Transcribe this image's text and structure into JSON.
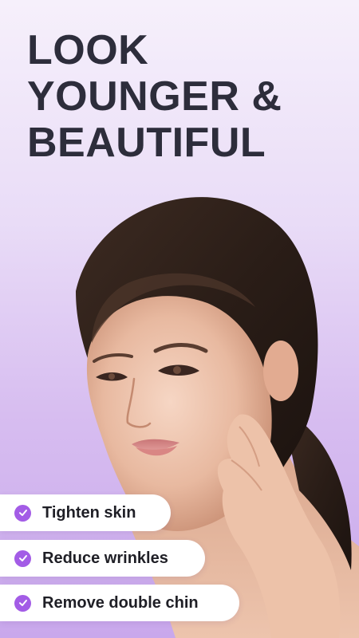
{
  "headline": {
    "line1": "LOOK",
    "line2": "YOUNGER &",
    "line3": "BEAUTIFUL"
  },
  "benefits": [
    {
      "label": "Tighten skin"
    },
    {
      "label": "Reduce wrinkles"
    },
    {
      "label": "Remove double chin"
    }
  ],
  "colors": {
    "background_top": "#f6f0fb",
    "background_bottom": "#c9a8ec",
    "headline_text": "#2d2d3b",
    "check_accent": "#a35ce6",
    "pill_background": "#ffffff"
  },
  "icons": {
    "check": "check-circle-icon"
  }
}
